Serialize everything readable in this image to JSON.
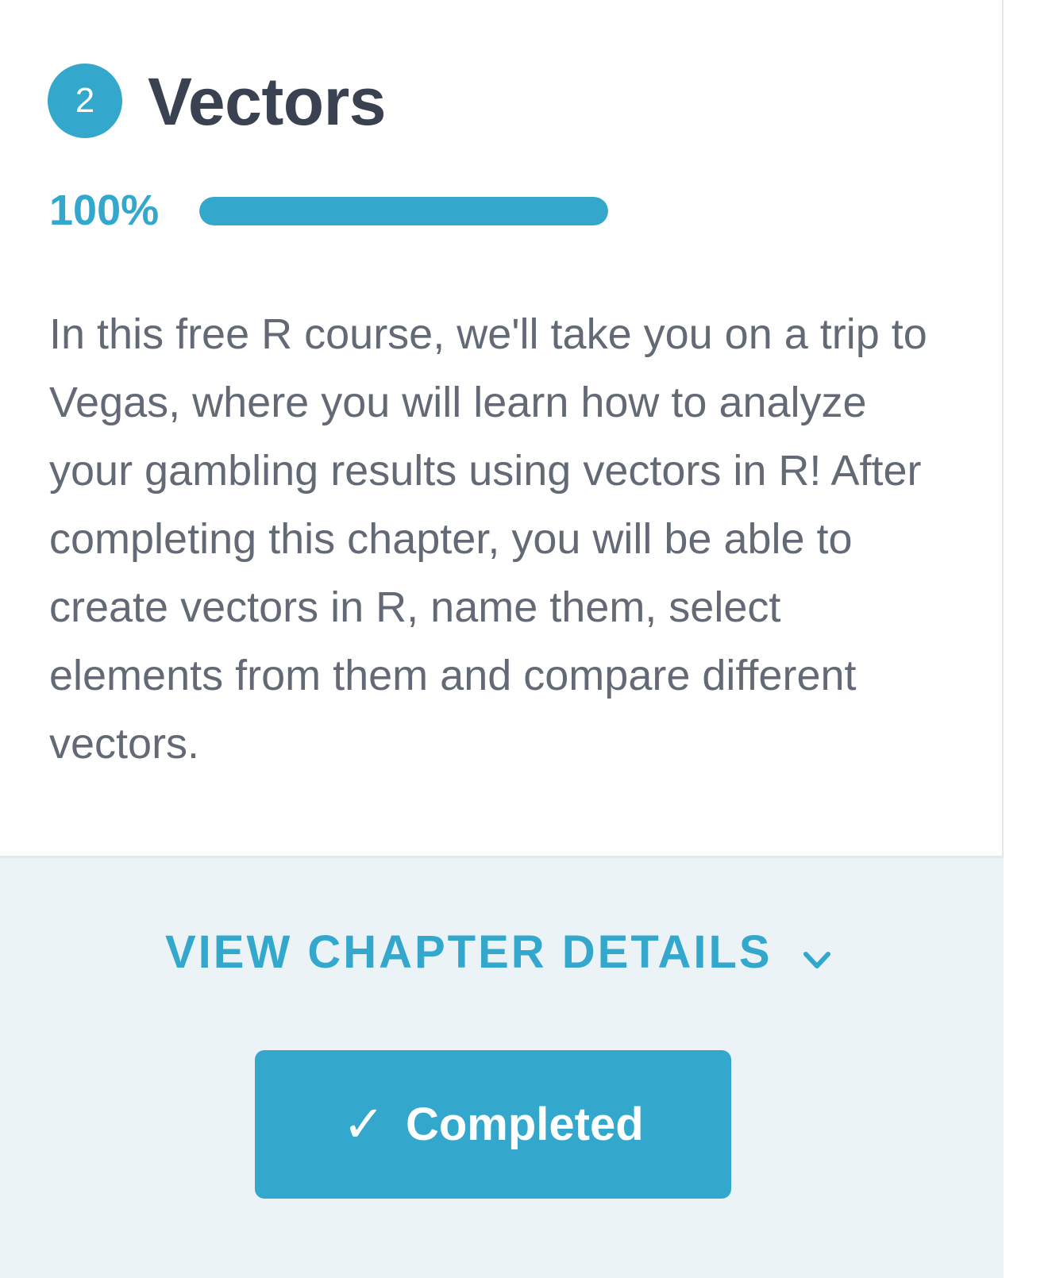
{
  "chapter": {
    "number": "2",
    "title": "Vectors",
    "progress_label": "100%",
    "progress_fraction": 1.0,
    "description": "In this free R course, we'll take you on a trip to Vegas, where you will learn how to analyze your gambling results using vectors in R! After completing this chapter, you will be able to create vectors in R, name them, select elements from them and compare different vectors."
  },
  "footer": {
    "details_link_label": "VIEW CHAPTER DETAILS",
    "details_icon": "chevron-down-icon",
    "completed_label": "Completed",
    "completed_icon": "checkmark-icon",
    "check_glyph": "✓"
  },
  "colors": {
    "accent": "#33a8cc",
    "title": "#3a4150",
    "body_text": "#636a75",
    "footer_bg": "#ebf3f6"
  }
}
